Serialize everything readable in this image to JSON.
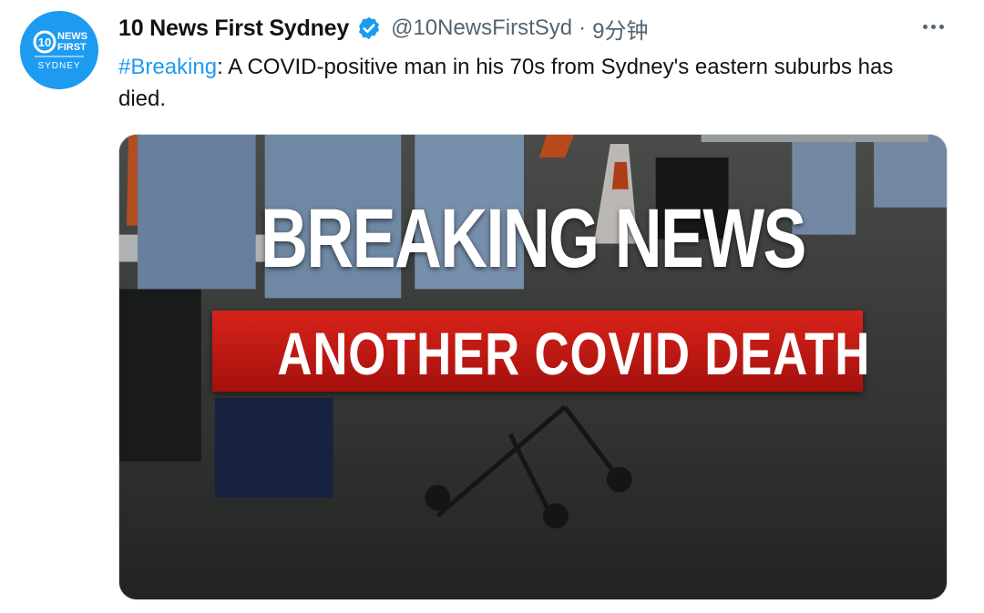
{
  "account": {
    "display_name": "10 News First Sydney",
    "handle": "@10NewsFirstSyd",
    "separator": "·",
    "timestamp": "9分钟",
    "verified": true,
    "avatar_text": {
      "number": "10",
      "line1": "NEWS",
      "line2": "FIRST",
      "line3": "SYDNEY"
    }
  },
  "tweet": {
    "hashtag": "#Breaking",
    "text": ": A COVID-positive man in his 70s from Sydney's eastern suburbs has died."
  },
  "media": {
    "headline": "BREAKING NEWS",
    "banner": "ANOTHER COVID DEATH",
    "banner_color": "#c4190f"
  },
  "icons": {
    "more": "more-horizontal-icon",
    "verified": "verified-badge-icon"
  },
  "colors": {
    "accent": "#1d9bf0",
    "text": "#0f1419",
    "secondary": "#536471"
  }
}
